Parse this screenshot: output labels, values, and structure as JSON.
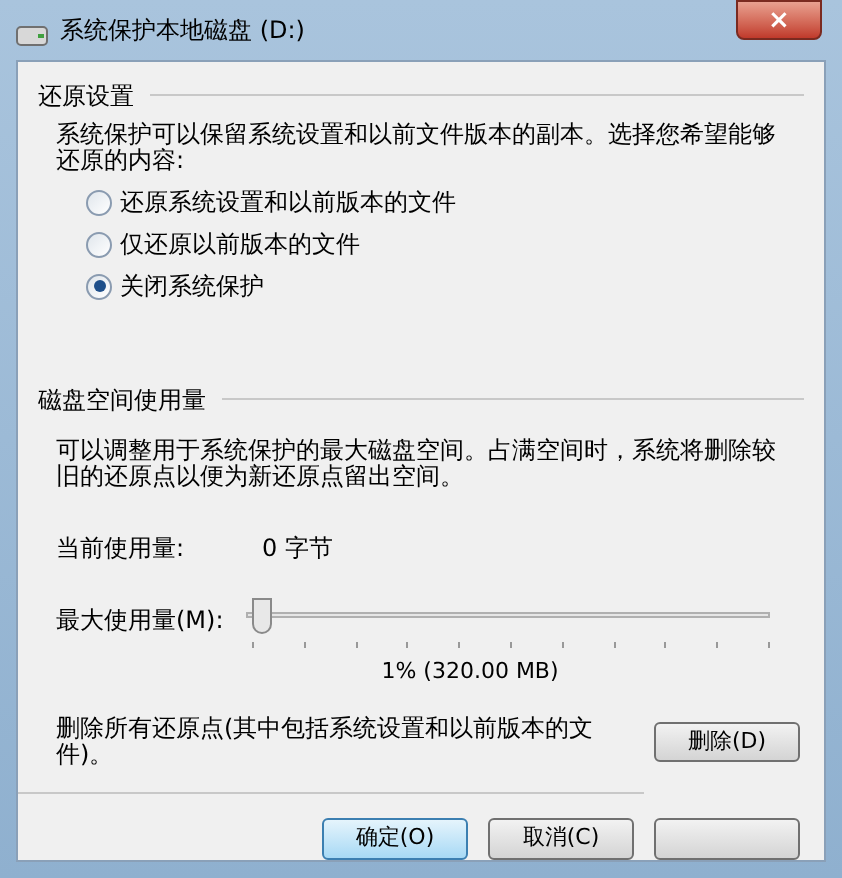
{
  "window": {
    "title": "系统保护本地磁盘 (D:)",
    "close": "×"
  },
  "restore_settings": {
    "heading": "还原设置",
    "description": "系统保护可以保留系统设置和以前文件版本的副本。选择您希望能够还原的内容:",
    "options": [
      {
        "label": "还原系统设置和以前版本的文件",
        "selected": false
      },
      {
        "label": "仅还原以前版本的文件",
        "selected": false
      },
      {
        "label": "关闭系统保护",
        "selected": true
      }
    ]
  },
  "disk_usage": {
    "heading": "磁盘空间使用量",
    "description": "可以调整用于系统保护的最大磁盘空间。占满空间时，系统将删除较旧的还原点以便为新还原点留出空间。",
    "current_label": "当前使用量:",
    "current_value": "0 字节",
    "max_label": "最大使用量(M):",
    "max_slider": {
      "level": 0.01
    },
    "max_reading": "1% (320.00 MB)",
    "delete_text": "删除所有还原点(其中包括系统设置和以前版本的文件)。",
    "delete_button": "删除(D)"
  },
  "buttons": [
    {
      "label": "确定(O)",
      "default": true
    },
    {
      "label": "取消(C)",
      "default": false
    },
    {
      "default": false
    }
  ]
}
